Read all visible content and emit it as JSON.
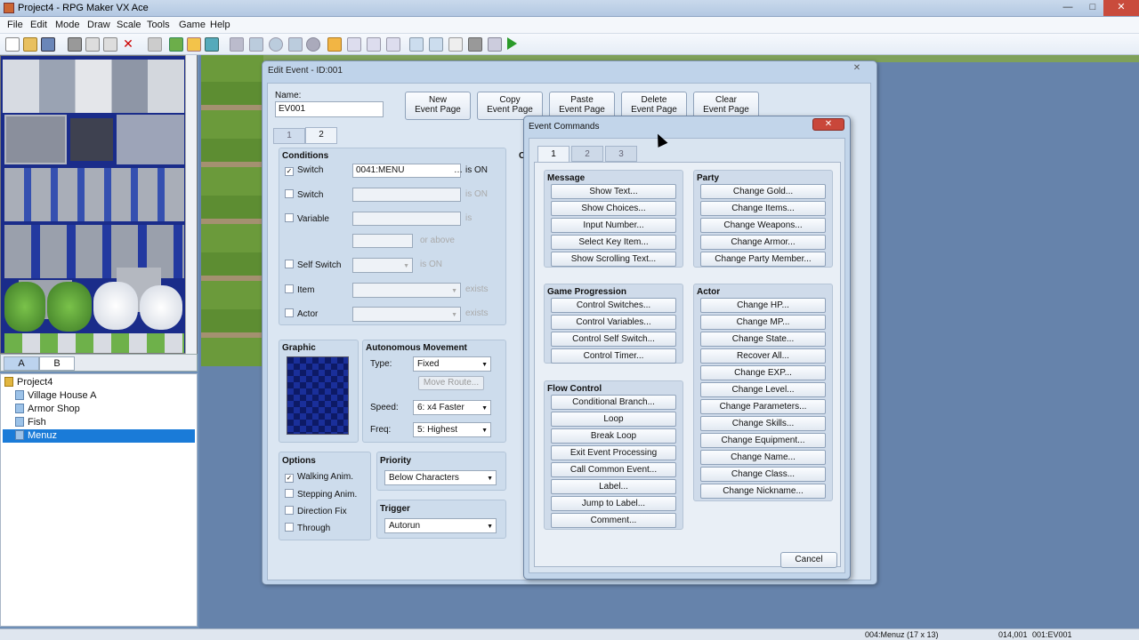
{
  "window": {
    "title": "Project4 - RPG Maker VX Ace",
    "min": "—",
    "max": "□",
    "close": "✕"
  },
  "menu": [
    "File",
    "Edit",
    "Mode",
    "Draw",
    "Scale",
    "Tools",
    "Game",
    "Help"
  ],
  "tileset_tabs": [
    "A",
    "B"
  ],
  "tree": {
    "root": "Project4",
    "items": [
      "Village House A",
      "Armor Shop",
      "Fish",
      "Menuz"
    ],
    "selected": "Menuz"
  },
  "status": {
    "map": "004:Menuz (17 x 13)",
    "coords": "014,001",
    "event": "001:EV001"
  },
  "edit_event": {
    "title": "Edit Event - ID:001",
    "name_label": "Name:",
    "name_value": "EV001",
    "buttons": [
      "New\nEvent Page",
      "Copy\nEvent Page",
      "Paste\nEvent Page",
      "Delete\nEvent Page",
      "Clear\nEvent Page"
    ],
    "page_tabs": [
      "1",
      "2"
    ],
    "conditions": {
      "title": "Conditions",
      "switch1_label": "Switch",
      "switch1_value": "0041:MENU",
      "switch1_suffix": "is ON",
      "switch2_label": "Switch",
      "switch2_suffix": "is ON",
      "variable_label": "Variable",
      "variable_suffix": "is",
      "above_suffix": "or above",
      "selfswitch_label": "Self Switch",
      "selfswitch_suffix": "is ON",
      "item_label": "Item",
      "item_suffix": "exists",
      "actor_label": "Actor",
      "actor_suffix": "exists"
    },
    "graphic": {
      "title": "Graphic"
    },
    "movement": {
      "title": "Autonomous Movement",
      "type_label": "Type:",
      "type_value": "Fixed",
      "move_route": "Move Route...",
      "speed_label": "Speed:",
      "speed_value": "6: x4 Faster",
      "freq_label": "Freq:",
      "freq_value": "5: Highest"
    },
    "options": {
      "title": "Options",
      "items": [
        "Walking Anim.",
        "Stepping Anim.",
        "Direction Fix",
        "Through"
      ]
    },
    "priority": {
      "title": "Priority",
      "value": "Below Characters"
    },
    "trigger": {
      "title": "Trigger",
      "value": "Autorun"
    },
    "contents_label": "Co"
  },
  "event_commands": {
    "title": "Event Commands",
    "close": "✕",
    "tabs": [
      "1",
      "2",
      "3"
    ],
    "groups": {
      "message": {
        "title": "Message",
        "items": [
          "Show Text...",
          "Show Choices...",
          "Input Number...",
          "Select Key Item...",
          "Show Scrolling Text..."
        ]
      },
      "game_progression": {
        "title": "Game Progression",
        "items": [
          "Control Switches...",
          "Control Variables...",
          "Control Self Switch...",
          "Control Timer..."
        ]
      },
      "flow_control": {
        "title": "Flow Control",
        "items": [
          "Conditional Branch...",
          "Loop",
          "Break Loop",
          "Exit Event Processing",
          "Call Common Event...",
          "Label...",
          "Jump to Label...",
          "Comment..."
        ]
      },
      "party": {
        "title": "Party",
        "items": [
          "Change Gold...",
          "Change Items...",
          "Change Weapons...",
          "Change Armor...",
          "Change Party Member..."
        ]
      },
      "actor": {
        "title": "Actor",
        "items": [
          "Change HP...",
          "Change MP...",
          "Change State...",
          "Recover All...",
          "Change EXP...",
          "Change Level...",
          "Change Parameters...",
          "Change Skills...",
          "Change Equipment...",
          "Change Name...",
          "Change Class...",
          "Change Nickname..."
        ]
      }
    },
    "cancel": "Cancel"
  }
}
